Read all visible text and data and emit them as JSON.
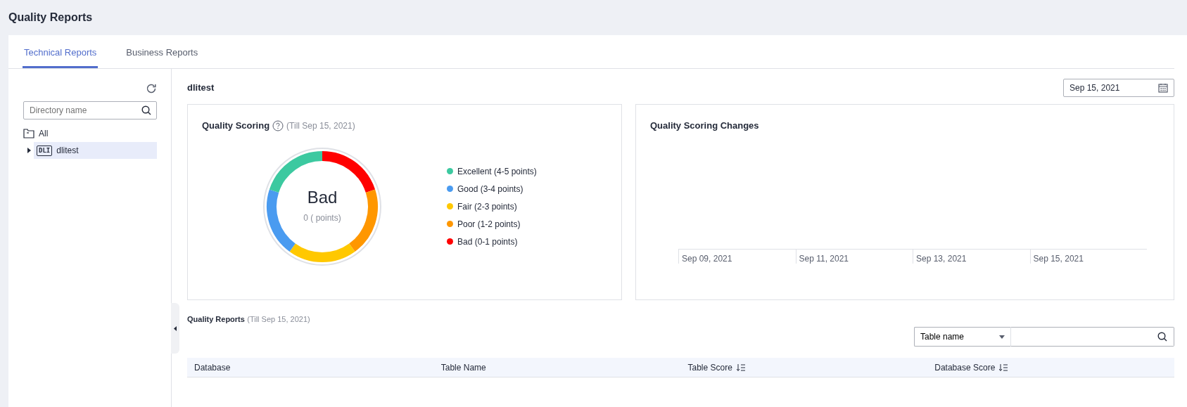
{
  "page_title": "Quality Reports",
  "tabs": [
    {
      "label": "Technical Reports",
      "selected": true
    },
    {
      "label": "Business Reports",
      "selected": false
    }
  ],
  "sidebar": {
    "search": {
      "placeholder": "Directory name"
    },
    "tree": [
      {
        "label": "All",
        "kind": "folder",
        "selected": false,
        "expanded": true,
        "children": [
          {
            "label": "dlitest",
            "kind": "database",
            "badge": "DLI",
            "selected": true,
            "expanded": false
          }
        ]
      }
    ]
  },
  "main": {
    "title": "dlitest",
    "date_picker": {
      "value": "Sep 15, 2021"
    },
    "scoring_card": {
      "title": "Quality Scoring",
      "subtitle": "(Till Sep 15, 2021)",
      "grade": "Bad",
      "points": "0 ( points)",
      "legend": [
        {
          "label": "Excellent (4-5 points)",
          "color": "#3cc9a0"
        },
        {
          "label": "Good (3-4 points)",
          "color": "#4a9bf0"
        },
        {
          "label": "Fair (2-3 points)",
          "color": "#ffc800"
        },
        {
          "label": "Poor (1-2 points)",
          "color": "#ff9700"
        },
        {
          "label": "Bad (0-1 points)",
          "color": "#ff0000"
        }
      ]
    },
    "changes_card": {
      "title": "Quality Scoring Changes",
      "x_labels": [
        "Sep 09, 2021",
        "Sep 11, 2021",
        "Sep 13, 2021",
        "Sep 15, 2021"
      ]
    },
    "reports": {
      "title": "Quality Reports",
      "subtitle": "(Till Sep 15, 2021)",
      "filter": {
        "value": "Table name"
      },
      "columns": [
        {
          "label": "Database",
          "sortable": false
        },
        {
          "label": "Table Name",
          "sortable": false
        },
        {
          "label": "Table Score",
          "sortable": true
        },
        {
          "label": "Database Score",
          "sortable": true
        }
      ]
    }
  }
}
